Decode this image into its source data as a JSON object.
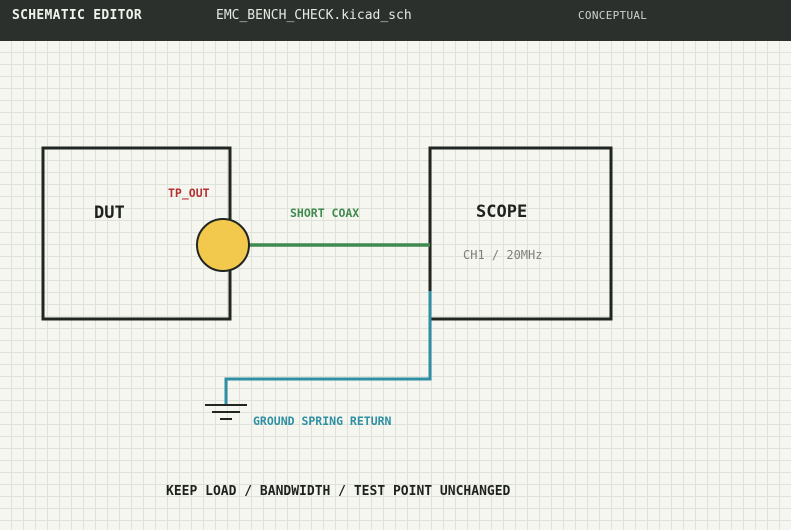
{
  "toolbar": {
    "app_title": "SCHEMATIC EDITOR",
    "file_name": "EMC_BENCH_CHECK.kicad_sch",
    "mode": "CONCEPTUAL"
  },
  "schematic": {
    "dut": {
      "label": "DUT"
    },
    "test_point": {
      "label": "TP_OUT",
      "color": "#f2c94c"
    },
    "scope": {
      "label": "SCOPE",
      "channel": "CH1 / 20MHz"
    },
    "signal_wire": {
      "label": "SHORT COAX",
      "color": "#3f8a4e"
    },
    "ground_wire": {
      "label": "GROUND SPRING RETURN",
      "color": "#2f8fa3"
    },
    "note": "KEEP LOAD / BANDWIDTH / TEST POINT UNCHANGED"
  },
  "colors": {
    "toolbar_bg": "#2b302c",
    "ink": "#222622",
    "test_point_label": "#b53030"
  }
}
